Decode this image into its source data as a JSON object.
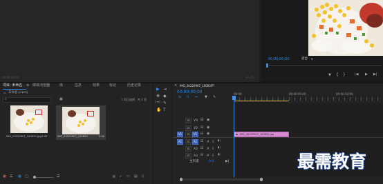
{
  "source_monitor": {
    "footer_left": "00;00;00;00",
    "footer_right": "+/- 15"
  },
  "program_monitor": {
    "timecode": "00;00;00;00",
    "fit": "适合",
    "fit_caret": "▼",
    "controls": [
      "▼",
      "{",
      "}",
      "|◀",
      "▶",
      "▶|"
    ]
  },
  "project": {
    "tabs": [
      "项目: 未命名",
      "媒体浏览器",
      "库",
      "信息",
      "效果",
      "标记",
      "历史记录"
    ],
    "menu_glyph": "≡",
    "file": "未命名.prproj",
    "search_placeholder": "",
    "selection_info": "1 项已选择，共 2 项",
    "items": [
      {
        "name": "IMG_20220907_100830.jpg",
        "duration": "5:00"
      },
      {
        "name": "IMG_20220907_100830",
        "duration": "5:00"
      }
    ]
  },
  "tools": [
    "▶",
    "⇥",
    "✥",
    "◆",
    "|↔|",
    "✎",
    "✋",
    "T"
  ],
  "timeline": {
    "tab_title": "IMG_20220907_100830",
    "timecode": "00:00:00:00",
    "ruler": [
      "00:00",
      "00:00:05:00",
      "00:00:10:00"
    ],
    "tracks": [
      "V3",
      "V2",
      "V1",
      "A1",
      "A2",
      "A3"
    ],
    "master_label": "主声道",
    "master_value": "0.0",
    "clip_name": "IMG_20220907_100830.jpg"
  },
  "watermark": "最需教育",
  "colors": {
    "accent": "#2d8ceb",
    "playhead": "#4a90e2",
    "clip": "#d98bd6",
    "work_area": "#e0c14a"
  }
}
